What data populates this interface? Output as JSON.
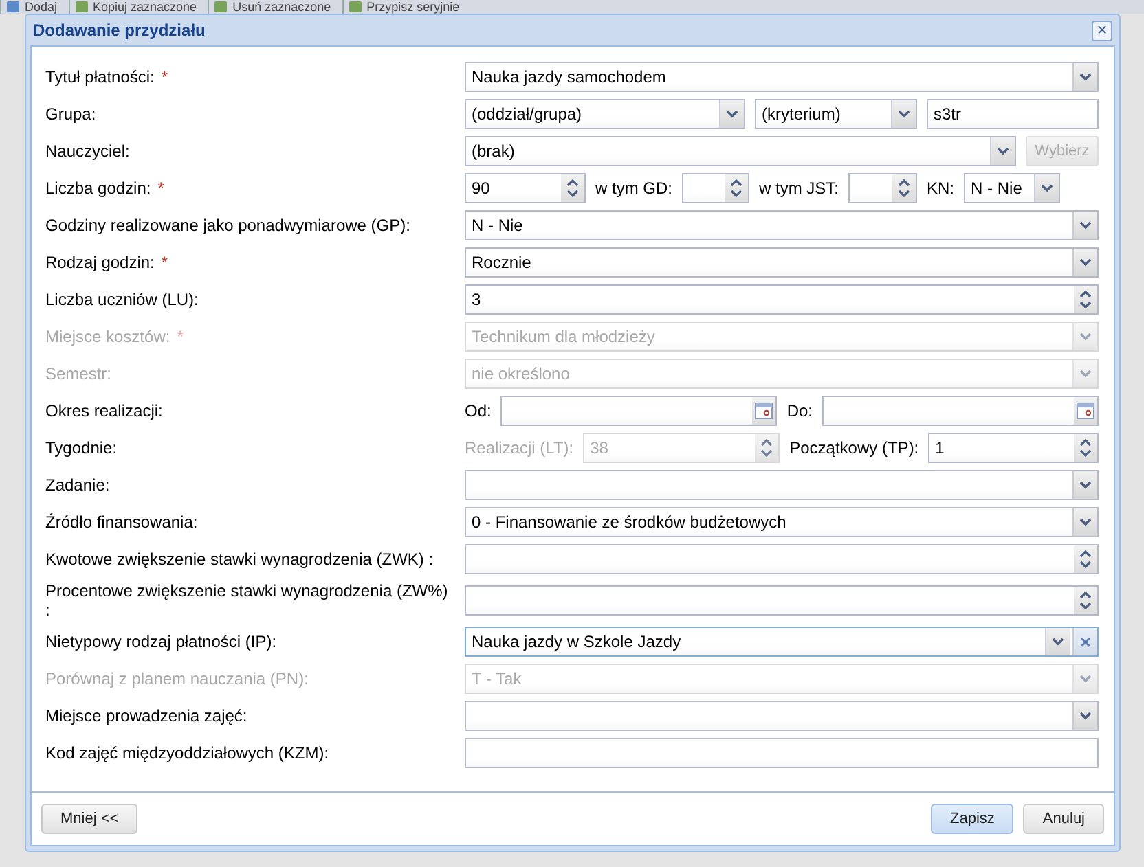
{
  "toolbar": {
    "items": [
      {
        "label": "Dodaj"
      },
      {
        "label": "Kopiuj zaznaczone"
      },
      {
        "label": "Usuń zaznaczone"
      },
      {
        "label": "Przypisz seryjnie"
      }
    ]
  },
  "dialog": {
    "title": "Dodawanie przydziału",
    "close": "×",
    "rows": [
      {
        "label": "Tytuł płatności:",
        "required_mark": "*",
        "disabled": false,
        "controls": [
          {
            "kind": "select",
            "value": "Nauka jazdy samochodem",
            "disabled": false
          }
        ]
      },
      {
        "label": "Grupa:",
        "disabled": false,
        "controls": [
          {
            "kind": "select",
            "value": "(oddział/grupa)",
            "disabled": false
          },
          {
            "kind": "select",
            "value": "(kryterium)",
            "disabled": false
          },
          {
            "kind": "text",
            "value": "s3tr",
            "disabled": false
          }
        ]
      },
      {
        "label": "Nauczyciel:",
        "disabled": false,
        "controls": [
          {
            "kind": "select",
            "value": "(brak)",
            "disabled": false
          },
          {
            "kind": "button",
            "value": "Wybierz",
            "disabled": true
          }
        ]
      },
      {
        "label": "Liczba godzin:",
        "required_mark": "*",
        "disabled": false,
        "controls": [
          {
            "kind": "spinner",
            "value": "90",
            "disabled": false
          },
          {
            "kind": "label",
            "value": "w tym GD:",
            "disabled": false
          },
          {
            "kind": "spinner",
            "disabled": false
          },
          {
            "kind": "label",
            "value": "w tym JST:",
            "disabled": false
          },
          {
            "kind": "spinner",
            "disabled": false
          },
          {
            "kind": "label",
            "value": "KN:",
            "disabled": false
          },
          {
            "kind": "select",
            "value": "N - Nie",
            "disabled": false
          }
        ]
      },
      {
        "label": "Godziny realizowane jako ponadwymiarowe (GP):",
        "disabled": false,
        "controls": [
          {
            "kind": "select",
            "value": "N - Nie",
            "disabled": false
          }
        ]
      },
      {
        "label": "Rodzaj godzin:",
        "required_mark": "*",
        "disabled": false,
        "controls": [
          {
            "kind": "select",
            "value": "Rocznie",
            "disabled": false
          }
        ]
      },
      {
        "label": "Liczba uczniów (LU):",
        "disabled": false,
        "controls": [
          {
            "kind": "spinner",
            "value": "3",
            "disabled": false
          }
        ]
      },
      {
        "label": "Miejsce kosztów:",
        "required_mark": "*",
        "disabled": true,
        "controls": [
          {
            "kind": "select",
            "value": "Technikum dla młodzieży",
            "disabled": true
          }
        ]
      },
      {
        "label": "Semestr:",
        "disabled": true,
        "controls": [
          {
            "kind": "select",
            "value": "nie określono",
            "disabled": true
          }
        ]
      },
      {
        "label": "Okres realizacji:",
        "disabled": false,
        "controls": [
          {
            "kind": "label",
            "value": "Od:",
            "disabled": false
          },
          {
            "kind": "date",
            "disabled": false
          },
          {
            "kind": "label",
            "value": "Do:",
            "disabled": false
          },
          {
            "kind": "date",
            "disabled": false
          }
        ]
      },
      {
        "label": "Tygodnie:",
        "disabled": false,
        "controls": [
          {
            "kind": "label",
            "value": "Realizacji (LT):",
            "disabled": true
          },
          {
            "kind": "spinner",
            "value": "38",
            "disabled": true
          },
          {
            "kind": "label",
            "value": "Początkowy (TP):",
            "disabled": false
          },
          {
            "kind": "spinner",
            "value": "1",
            "disabled": false
          }
        ]
      },
      {
        "label": "Zadanie:",
        "disabled": false,
        "controls": [
          {
            "kind": "select",
            "disabled": false
          }
        ]
      },
      {
        "label": "Źródło finansowania:",
        "disabled": false,
        "controls": [
          {
            "kind": "select",
            "value": "0 - Finansowanie ze środków budżetowych",
            "disabled": false
          }
        ]
      },
      {
        "label": "Kwotowe zwiększenie stawki wynagrodzenia (ZWK) :",
        "disabled": false,
        "controls": [
          {
            "kind": "spinner",
            "disabled": false
          }
        ]
      },
      {
        "label": "Procentowe zwiększenie stawki wynagrodzenia (ZW%) :",
        "disabled": false,
        "controls": [
          {
            "kind": "spinner",
            "disabled": false
          }
        ]
      },
      {
        "label": "Nietypowy rodzaj płatności (IP):",
        "disabled": false,
        "controls": [
          {
            "kind": "select-clear",
            "value": "Nauka jazdy w Szkole Jazdy",
            "clear": "×",
            "disabled": false
          }
        ]
      },
      {
        "label": "Porównaj z planem nauczania (PN):",
        "disabled": true,
        "controls": [
          {
            "kind": "select",
            "value": "T - Tak",
            "disabled": true
          }
        ]
      },
      {
        "label": "Miejsce prowadzenia zajęć:",
        "disabled": false,
        "controls": [
          {
            "kind": "select",
            "disabled": false
          }
        ]
      },
      {
        "label": "Kod zajęć międzyoddziałowych (KZM):",
        "disabled": false,
        "controls": [
          {
            "kind": "text",
            "disabled": false
          }
        ]
      }
    ],
    "footer": {
      "left_button": {
        "label": "Mniej <<",
        "hovered": false
      },
      "buttons": [
        {
          "label": "Zapisz",
          "hovered": true
        },
        {
          "label": "Anuluj",
          "hovered": false
        }
      ]
    }
  }
}
